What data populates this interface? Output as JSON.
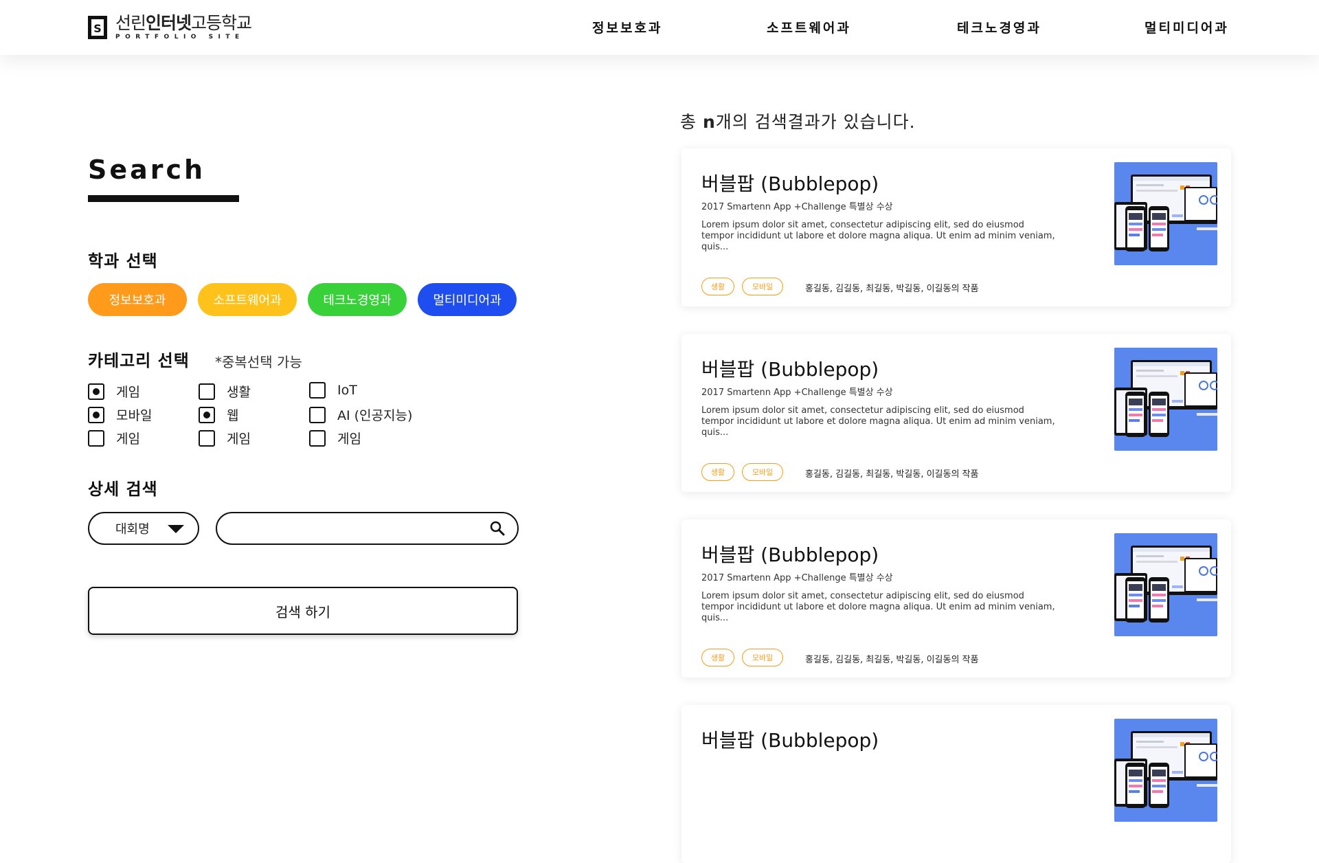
{
  "header": {
    "logo_title_prefix": "선린",
    "logo_title_bold": "인터넷",
    "logo_title_suffix": "고등학교",
    "logo_subtitle": "PORTFOLIO SITE",
    "nav": [
      "정보보호과",
      "소프트웨어과",
      "테크노경영과",
      "멀티미디어과"
    ]
  },
  "search": {
    "title": "Search",
    "dept_label": "학과 선택",
    "departments": [
      {
        "label": "정보보호과",
        "color": "#ff9a1a"
      },
      {
        "label": "소프트웨어과",
        "color": "#ffc21a"
      },
      {
        "label": "테크노경영과",
        "color": "#38d13a"
      },
      {
        "label": "멀티미디어과",
        "color": "#1f4ef0"
      }
    ],
    "category_label": "카테고리 선택",
    "category_note": "*중복선택 가능",
    "categories": [
      {
        "label": "게임",
        "checked": true
      },
      {
        "label": "생활",
        "checked": false
      },
      {
        "label": "IoT",
        "checked": false
      },
      {
        "label": "모바일",
        "checked": true
      },
      {
        "label": "웹",
        "checked": true
      },
      {
        "label": "AI (인공지능)",
        "checked": false
      },
      {
        "label": "게임",
        "checked": false
      },
      {
        "label": "게임",
        "checked": false
      },
      {
        "label": "게임",
        "checked": false
      }
    ],
    "detail_label": "상세 검색",
    "filter_select": "대회명",
    "query_value": "",
    "query_placeholder": "",
    "submit_label": "검색 하기"
  },
  "results": {
    "count_prefix": "총 ",
    "count_value": "n",
    "count_suffix": "개의 검색결과가 있습니다.",
    "cards": [
      {
        "title": "버블팝 (Bubblepop)",
        "award": "2017 Smartenn App +Challenge 특별상 수상",
        "description": "Lorem ipsum dolor sit amet, consectetur adipiscing elit, sed do eiusmod tempor incididunt ut labore et dolore magna aliqua. Ut enim ad minim veniam, quis...",
        "tags": [
          "생활",
          "모바일"
        ],
        "authors": "홍길동, 김길동, 최길동, 박길동, 이길동의 작품"
      },
      {
        "title": "버블팝 (Bubblepop)",
        "award": "2017 Smartenn App +Challenge 특별상 수상",
        "description": "Lorem ipsum dolor sit amet, consectetur adipiscing elit, sed do eiusmod tempor incididunt ut labore et dolore magna aliqua. Ut enim ad minim veniam, quis...",
        "tags": [
          "생활",
          "모바일"
        ],
        "authors": "홍길동, 김길동, 최길동, 박길동, 이길동의 작품"
      },
      {
        "title": "버블팝 (Bubblepop)",
        "award": "2017 Smartenn App +Challenge 특별상 수상",
        "description": "Lorem ipsum dolor sit amet, consectetur adipiscing elit, sed do eiusmod tempor incididunt ut labore et dolore magna aliqua. Ut enim ad minim veniam, quis...",
        "tags": [
          "생활",
          "모바일"
        ],
        "authors": "홍길동, 김길동, 최길동, 박길동, 이길동의 작품"
      },
      {
        "title": "버블팝 (Bubblepop)",
        "award": "",
        "description": "",
        "tags": [],
        "authors": ""
      }
    ]
  }
}
